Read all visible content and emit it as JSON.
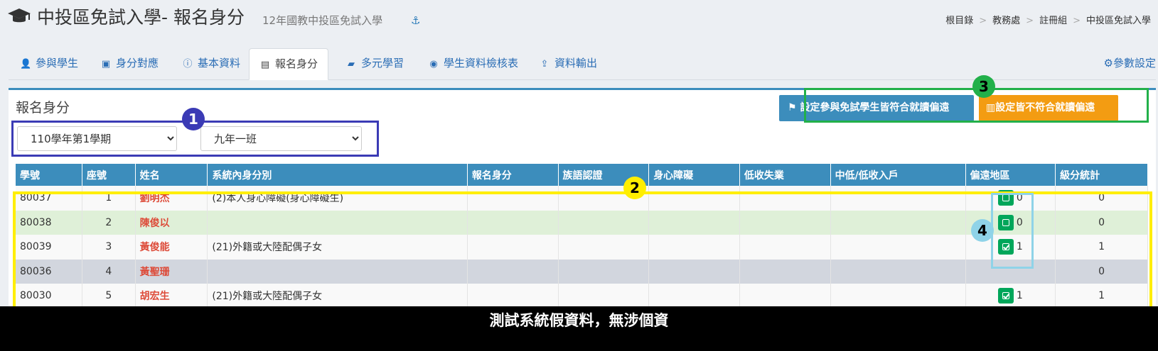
{
  "header": {
    "title": "中投區免試入學- 報名身分",
    "subtitle": "12年國教中投區免試入學",
    "icon": "graduation-cap-icon",
    "breadcrumb": [
      "根目錄",
      "教務處",
      "註冊組",
      "中投區免試入學"
    ]
  },
  "tabs": [
    {
      "label": "參與學生",
      "icon": "user-plus-icon"
    },
    {
      "label": "身分對應",
      "icon": "id-badge-icon"
    },
    {
      "label": "基本資料",
      "icon": "info-icon"
    },
    {
      "label": "報名身分",
      "icon": "id-card-icon",
      "active": true
    },
    {
      "label": "多元學習",
      "icon": "book-icon"
    },
    {
      "label": "學生資料檢核表",
      "icon": "eye-icon"
    },
    {
      "label": "資料輸出",
      "icon": "upload-icon"
    }
  ],
  "settings_tab": {
    "label": "參數設定",
    "icon": "gear-icon"
  },
  "panel": {
    "title": "報名身分",
    "semester_select": "110學年第1學期",
    "class_select": "九年一班",
    "btn_all_remote": "設定參與免試學生皆符合就讀偏遠",
    "btn_none_remote": "設定皆不符合就讀偏遠"
  },
  "table": {
    "columns": [
      "學號",
      "座號",
      "姓名",
      "系統內身分別",
      "報名身分",
      "族語認證",
      "身心障礙",
      "低收失業",
      "中低/低收入戶",
      "偏遠地區",
      "級分統計"
    ],
    "rows": [
      {
        "id": "80037",
        "seat": "1",
        "name": "劉明杰",
        "identity": "(2)本人身心障礙(身心障礙生)",
        "remote_checked": false,
        "remote_value": "0",
        "total": "0"
      },
      {
        "id": "80038",
        "seat": "2",
        "name": "陳俊以",
        "identity": "",
        "remote_checked": false,
        "remote_value": "0",
        "total": "0"
      },
      {
        "id": "80039",
        "seat": "3",
        "name": "黃俊能",
        "identity": "(21)外籍或大陸配偶子女",
        "remote_checked": true,
        "remote_value": "1",
        "total": "1"
      },
      {
        "id": "80036",
        "seat": "4",
        "name": "黃聖珊",
        "identity": "",
        "remote_checked": null,
        "remote_value": "",
        "total": "0"
      },
      {
        "id": "80030",
        "seat": "5",
        "name": "胡宏生",
        "identity": "(21)外籍或大陸配偶子女",
        "remote_checked": true,
        "remote_value": "1",
        "total": "1"
      }
    ]
  },
  "annotations": [
    "1",
    "2",
    "3",
    "4"
  ],
  "footer": "測試系統假資料，無涉個資",
  "colors": {
    "primary": "#3c8dbc",
    "orange": "#f39c12",
    "green": "#00a65a",
    "name_red": "#dd4b39",
    "annotation_blue": "#3b3bb5",
    "annotation_yellow": "#ffee00",
    "annotation_green": "#22b04a",
    "annotation_lightblue": "#8fd3e8"
  }
}
